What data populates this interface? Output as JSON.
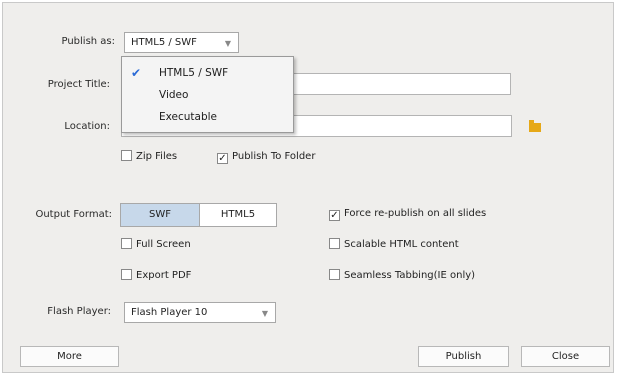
{
  "publish_as": {
    "label": "Publish as:",
    "value": "HTML5 / SWF",
    "options": [
      "HTML5 / SWF",
      "Video",
      "Executable"
    ],
    "selected": "HTML5 / SWF"
  },
  "project_title": {
    "label": "Project Title:",
    "value": ""
  },
  "location": {
    "label": "Location:",
    "value": "",
    "folder_icon": "folder-icon"
  },
  "zip_files": {
    "label": "Zip Files",
    "checked": false
  },
  "publish_to_folder": {
    "label": "Publish To Folder",
    "checked": true
  },
  "output_format": {
    "label": "Output Format:",
    "options": [
      "SWF",
      "HTML5"
    ],
    "selected": "SWF"
  },
  "full_screen": {
    "label": "Full Screen",
    "checked": false
  },
  "export_pdf": {
    "label": "Export PDF",
    "checked": false
  },
  "force_republish": {
    "label": "Force re-publish on all slides",
    "checked": true
  },
  "scalable_html": {
    "label": "Scalable HTML content",
    "checked": false
  },
  "seamless_tabbing": {
    "label": "Seamless Tabbing(IE only)",
    "checked": false
  },
  "flash_player": {
    "label": "Flash Player:",
    "value": "Flash Player 10"
  },
  "buttons": {
    "more": "More",
    "publish": "Publish",
    "close": "Close"
  },
  "colors": {
    "dialog_bg": "#efeeec",
    "selected_segment": "#c7d8ea",
    "checkmark": "#2a6ad6",
    "folder": "#e6a817"
  }
}
